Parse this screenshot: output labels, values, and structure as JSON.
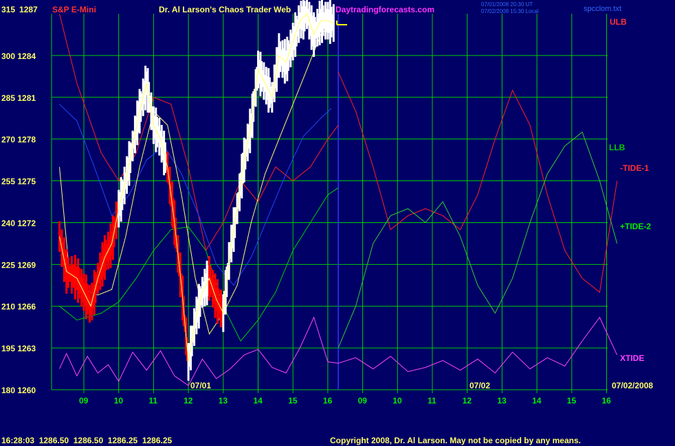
{
  "header": {
    "symbol": "S&P E-Mini",
    "title": "Dr. Al Larson's Chaos Trader Web",
    "site": "Daytradingforecasts.com",
    "timestamp_1": "07/01/2008 20:30 UT",
    "timestamp_2": "07/02/2008 15:30 Local",
    "file": "spcclom.txt"
  },
  "footer": {
    "quote": "16:28:03  1286.50  1286.50  1286.25  1286.25",
    "copyright": "Copyright 2008, Dr. Al Larson. May not be copied by any means."
  },
  "colors": {
    "background": "#000066",
    "grid": "#00cc00",
    "price": "#ffffff",
    "price_down": "#ff0000",
    "ulb": "#ff2020",
    "llb": "#00cc00",
    "tide1": "#ff2020",
    "tide2": "#33cc33",
    "xtide": "#ff44ff",
    "blue_ma": "#2244ff",
    "yellow_ma": "#ffff66",
    "now_line": "#3333ff"
  },
  "chart_data": {
    "type": "line",
    "y_left_ticks": [
      "315",
      "300",
      "285",
      "270",
      "255",
      "240",
      "225",
      "210",
      "195",
      "180"
    ],
    "y_right_ticks": [
      "1287",
      "1284",
      "1281",
      "1278",
      "1275",
      "1272",
      "1269",
      "1266",
      "1263",
      "1260"
    ],
    "ylim": [
      1260,
      1287
    ],
    "x_ticks": [
      "09",
      "10",
      "11",
      "12",
      "13",
      "14",
      "15",
      "16",
      "09",
      "10",
      "11",
      "12",
      "13",
      "14",
      "15",
      "16"
    ],
    "date_markers": [
      {
        "label": "07/01",
        "at": 11.5
      },
      {
        "label": "07/02",
        "at": 12.5
      }
    ],
    "end_date": "07/02/2008",
    "labels": {
      "ulb": "ULB",
      "llb": "LLB",
      "tide1": "-TIDE-1",
      "tide2": "+TIDE-2",
      "xtide": "XTIDE"
    },
    "series": [
      {
        "name": "ULB",
        "key": "ulb",
        "x": [
          8.3,
          8.8,
          9.5,
          10,
          10.5,
          11,
          11.5,
          12,
          12.5,
          13,
          13.5,
          14,
          14.5,
          15,
          15.5,
          16,
          16.3
        ],
        "values": [
          1287,
          1282,
          1277,
          1275,
          1277,
          1281,
          1280.5,
          1276,
          1270,
          1272,
          1275,
          1273.5,
          1276,
          1275,
          1276,
          1278,
          1279
        ]
      },
      {
        "name": "LLB",
        "key": "llb",
        "x": [
          8.3,
          8.8,
          9.5,
          10,
          10.5,
          11,
          11.5,
          12,
          12.5,
          13,
          13.5,
          14,
          14.5,
          15,
          15.5,
          16,
          16.3
        ],
        "values": [
          1266,
          1265,
          1265.5,
          1266.3,
          1268,
          1270,
          1271.5,
          1271.7,
          1270,
          1266,
          1263.5,
          1265,
          1267,
          1270,
          1272,
          1274,
          1274.5
        ]
      },
      {
        "name": "-TIDE-1",
        "key": "tide1",
        "x": [
          16.3,
          16.8,
          17.3,
          17.8,
          18.3,
          18.8,
          19.3,
          19.8,
          20.3,
          20.8,
          21.3,
          21.8,
          22.3,
          22.8,
          23.3,
          23.8,
          24.3
        ],
        "values": [
          1282.8,
          1280,
          1276,
          1271.5,
          1272.5,
          1273,
          1272.5,
          1271.5,
          1274,
          1278,
          1281.5,
          1279,
          1274,
          1270,
          1268,
          1267,
          1275
        ]
      },
      {
        "name": "+TIDE-2",
        "key": "tide2",
        "x": [
          16.3,
          16.8,
          17.3,
          17.8,
          18.3,
          18.8,
          19.3,
          19.8,
          20.3,
          20.8,
          21.3,
          21.8,
          22.3,
          22.8,
          23.3,
          23.8,
          24.3
        ],
        "values": [
          1263,
          1266,
          1270.5,
          1272.5,
          1273,
          1272,
          1273.5,
          1271,
          1267.5,
          1265.5,
          1268,
          1272,
          1275.5,
          1277.5,
          1278.5,
          1275,
          1270.5
        ]
      },
      {
        "name": "XTIDE",
        "key": "xtide",
        "x": [
          8.3,
          8.5,
          8.8,
          9.1,
          9.4,
          9.7,
          10,
          10.4,
          10.8,
          11.2,
          11.6,
          12,
          12.4,
          12.8,
          13.2,
          13.6,
          14,
          14.4,
          14.8,
          15.2,
          15.6,
          16,
          16.3,
          16.8,
          17.3,
          17.8,
          18.3,
          18.8,
          19.3,
          19.8,
          20.3,
          20.8,
          21.3,
          21.8,
          22.3,
          22.8,
          23.3,
          23.8,
          24.3
        ],
        "values": [
          1261.5,
          1262.6,
          1261,
          1262.4,
          1261.2,
          1261.8,
          1260.6,
          1262.7,
          1261.4,
          1262.8,
          1261,
          1260.3,
          1262.2,
          1260.8,
          1261.5,
          1262.5,
          1262.9,
          1261.6,
          1261.2,
          1263,
          1265.2,
          1262,
          1261.9,
          1262.3,
          1261.5,
          1262.4,
          1261.3,
          1261.6,
          1262.1,
          1261.4,
          1262.2,
          1261.2,
          1262.7,
          1261.5,
          1262.3,
          1261.7,
          1263.5,
          1265.2,
          1262.5
        ]
      },
      {
        "name": "blue",
        "key": "blue_ma",
        "x": [
          8.3,
          8.8,
          9.3,
          9.8,
          10.3,
          10.8,
          11.3,
          11.8,
          12.3,
          12.8,
          13.3,
          13.8,
          14.3,
          14.8,
          15.3,
          15.8,
          16.1
        ],
        "values": [
          1280.5,
          1279.3,
          1276,
          1272.5,
          1274,
          1276.5,
          1277.5,
          1275.5,
          1272.5,
          1269,
          1267.5,
          1269.5,
          1272.5,
          1275.5,
          1278.2,
          1279.5,
          1280.2
        ]
      },
      {
        "name": "yellow",
        "key": "yellow_ma",
        "x": [
          8.3,
          8.6,
          9,
          9.4,
          9.8,
          10.2,
          10.6,
          11,
          11.4,
          11.8,
          12.2,
          12.6,
          13,
          13.4,
          13.8,
          14.2,
          14.6,
          15,
          15.4,
          15.8,
          16.2
        ],
        "values": [
          1276,
          1268,
          1267.2,
          1266.8,
          1267.2,
          1271,
          1276,
          1280,
          1279,
          1274,
          1268,
          1264,
          1265.5,
          1267.5,
          1272,
          1275.5,
          1278,
          1280.5,
          1283,
          1285.5,
          1286.5
        ]
      },
      {
        "name": "price",
        "key": "price",
        "x": [
          8.3,
          8.5,
          8.8,
          9,
          9.2,
          9.4,
          9.6,
          9.8,
          10,
          10.2,
          10.4,
          10.6,
          10.8,
          11,
          11.2,
          11.4,
          11.6,
          11.8,
          12,
          12.2,
          12.4,
          12.6,
          12.8,
          13,
          13.2,
          13.4,
          13.6,
          13.8,
          14,
          14.2,
          14.4,
          14.6,
          14.8,
          15,
          15.2,
          15.4,
          15.6,
          15.8,
          16,
          16.2
        ],
        "values": [
          1271,
          1268.5,
          1268,
          1267,
          1266,
          1268,
          1269.5,
          1270.5,
          1273,
          1275,
          1277.5,
          1280,
          1282,
          1279,
          1278,
          1276,
          1272,
          1267.5,
          1262,
          1265,
          1267,
          1268,
          1266.5,
          1265.5,
          1270,
          1273,
          1276.5,
          1279,
          1283,
          1282,
          1281,
          1284,
          1283.5,
          1285,
          1286.5,
          1287,
          1285.5,
          1286.5,
          1286.5,
          1286.3
        ]
      }
    ]
  }
}
